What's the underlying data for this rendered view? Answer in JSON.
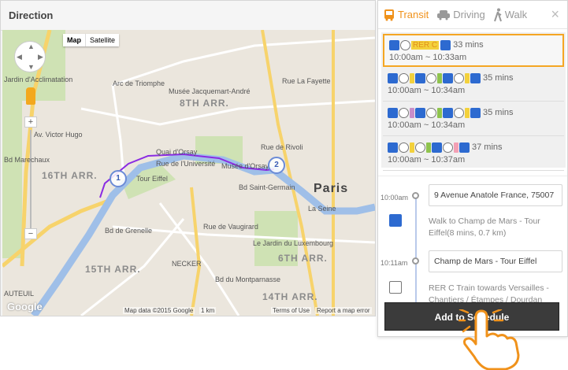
{
  "direction": {
    "title": "Direction"
  },
  "map": {
    "map_type": [
      "Map",
      "Satellite"
    ],
    "labels": {
      "jardin": "Jardin d'Acclimatation",
      "arc": "Arc de Triomphe",
      "jacquemart": "Musée Jacquemart-André",
      "arr8": "8TH ARR.",
      "arr16": "16TH ARR.",
      "arr15": "15TH ARR.",
      "arr6": "6TH ARR.",
      "arr14": "14TH ARR.",
      "paris": "Paris",
      "eiffel": "Tour Eiffel",
      "orsay": "Musée d'Orsay",
      "luxembourg": "Le Jardin du Luxembourg",
      "necker": "NECKER",
      "auteuil": "AUTEUIL",
      "seine": "La Seine",
      "quai": "Quai d'Orsay",
      "universite": "Rue de l'Université",
      "victor_hugo": "Av. Victor Hugo",
      "vaugirard": "Rue de Vaugirard",
      "rivoli": "Rue de Rivoli",
      "lafayette": "Rue La Fayette",
      "grenelle": "Bd de Grenelle",
      "montparnasse": "Bd du Montparnasse",
      "saint_germain": "Bd Saint-Germain",
      "marechaux": "Bd Marechaux"
    },
    "markers": [
      "1",
      "2"
    ],
    "footer": {
      "logo": "Google",
      "data": "Map data ©2015 Google",
      "scale": "1 km",
      "terms": "Terms of Use",
      "report": "Report a map error"
    }
  },
  "modes": {
    "transit": "Transit",
    "driving": "Driving",
    "walk": "Walk",
    "close": "×"
  },
  "routes": [
    {
      "line": "RER C",
      "duration": "33 mins",
      "time": "10:00am ~ 10:33am"
    },
    {
      "duration": "35 mins",
      "time": "10:00am ~ 10:34am"
    },
    {
      "duration": "35 mins",
      "time": "10:00am ~ 10:34am"
    },
    {
      "duration": "37 mins",
      "time": "10:00am ~ 10:37am"
    }
  ],
  "steps": [
    {
      "time": "10:00am",
      "address": "9 Avenue Anatole France, 75007",
      "desc": "Walk to Champ de Mars - Tour Eiffel(8 mins, 0.7 km)"
    },
    {
      "time": "10:11am",
      "address": "Champ de Mars - Tour Eiffel",
      "desc": "RER C Train towards Versailles - Chantiers / Étampes / Dourdan"
    }
  ],
  "add_button": "Add to Schedule",
  "colors": {
    "accent": "#f0921b",
    "walk_icon": "#2d6ad0",
    "route_line": "#8a2be2",
    "river": "#9fbfe8"
  }
}
